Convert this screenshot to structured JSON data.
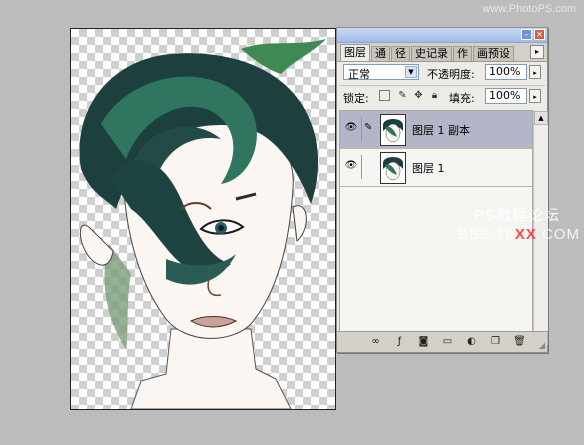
{
  "watermark_top": "www.PhotoPS.com",
  "palette": {
    "tabs": [
      {
        "label": "图层",
        "active": true
      },
      {
        "label": "通",
        "active": false
      },
      {
        "label": "径",
        "active": false
      },
      {
        "label": "史记录",
        "active": false
      },
      {
        "label": "作",
        "active": false
      },
      {
        "label": "画预设",
        "active": false
      }
    ],
    "tab_menu_icon": "▸",
    "blend_mode": "正常",
    "opacity_label": "不透明度:",
    "opacity_value": "100%",
    "lock_label": "锁定:",
    "fill_label": "填充:",
    "fill_value": "100%",
    "layers": [
      {
        "name": "图层 1 副本",
        "selected": true,
        "visible": true
      },
      {
        "name": "图层 1",
        "selected": false,
        "visible": true
      }
    ]
  },
  "watermark": {
    "line1": "PS教程论坛",
    "line2_a": "BBS.16",
    "line2_b": "XX",
    "line2_c": ".COM"
  },
  "colors": {
    "hair_dark": "#1d3f3d",
    "hair_teal": "#2f7560",
    "skin": "#fbf6f2",
    "accent_red": "#ff2a2a"
  }
}
